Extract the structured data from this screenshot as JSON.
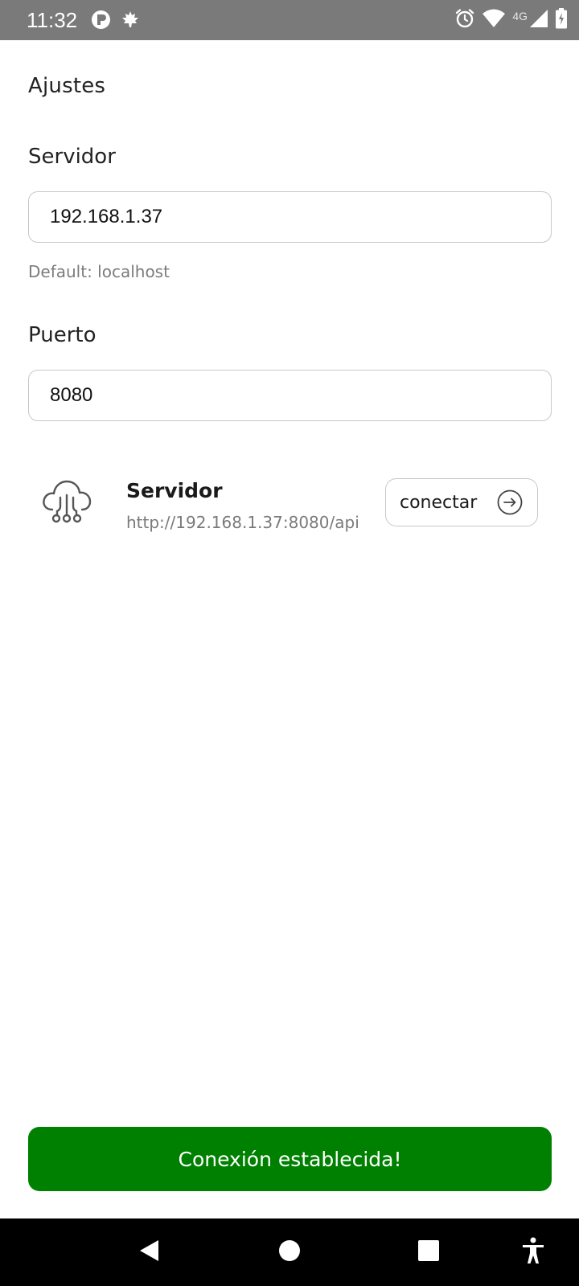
{
  "status_bar": {
    "time": "11:32",
    "network_label": "4G",
    "left_icons": [
      "app-notification-icon",
      "leaf-notification-icon"
    ],
    "right_icons": [
      "alarm-icon",
      "wifi-icon",
      "signal-icon",
      "battery-charging-icon"
    ]
  },
  "page": {
    "title": "Ajustes"
  },
  "server_field": {
    "label": "Servidor",
    "value": "192.168.1.37",
    "helper": "Default: localhost"
  },
  "port_field": {
    "label": "Puerto",
    "value": "8080"
  },
  "server_card": {
    "icon": "cloud-network-icon",
    "title": "Servidor",
    "url": "http://192.168.1.37:8080/api",
    "button_label": "conectar",
    "button_icon": "arrow-right-circle-icon"
  },
  "banner": {
    "text": "Conexión establecida!",
    "color": "#008000"
  },
  "nav_bar": {
    "buttons": [
      "back-icon",
      "home-icon",
      "recents-icon",
      "accessibility-icon"
    ]
  }
}
